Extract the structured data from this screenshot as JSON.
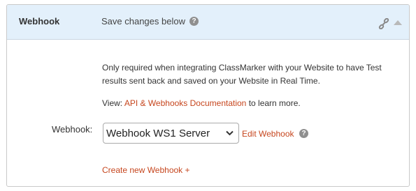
{
  "header": {
    "title": "Webhook",
    "subtitle": "Save changes below",
    "help_glyph": "?",
    "icons": [
      "link-icon",
      "collapse-arrow-icon",
      "help-icon"
    ]
  },
  "description": {
    "text": "Only required when integrating ClassMarker with your Website to have Test results sent back and saved on your Website in Real Time."
  },
  "view": {
    "prefix": "View: ",
    "link_label": "API & Webhooks Documentation",
    "suffix": " to learn more."
  },
  "webhook_field": {
    "label": "Webhook:",
    "selected_value": "Webhook WS1 Server",
    "edit_label": "Edit Webhook",
    "help_glyph": "?"
  },
  "create_link": {
    "label": "Create new Webhook +"
  },
  "colors": {
    "header_bg": "#e3f0fb",
    "link": "#c6461e",
    "border": "#c9c9c9",
    "help_icon": "#8f8f8f"
  }
}
